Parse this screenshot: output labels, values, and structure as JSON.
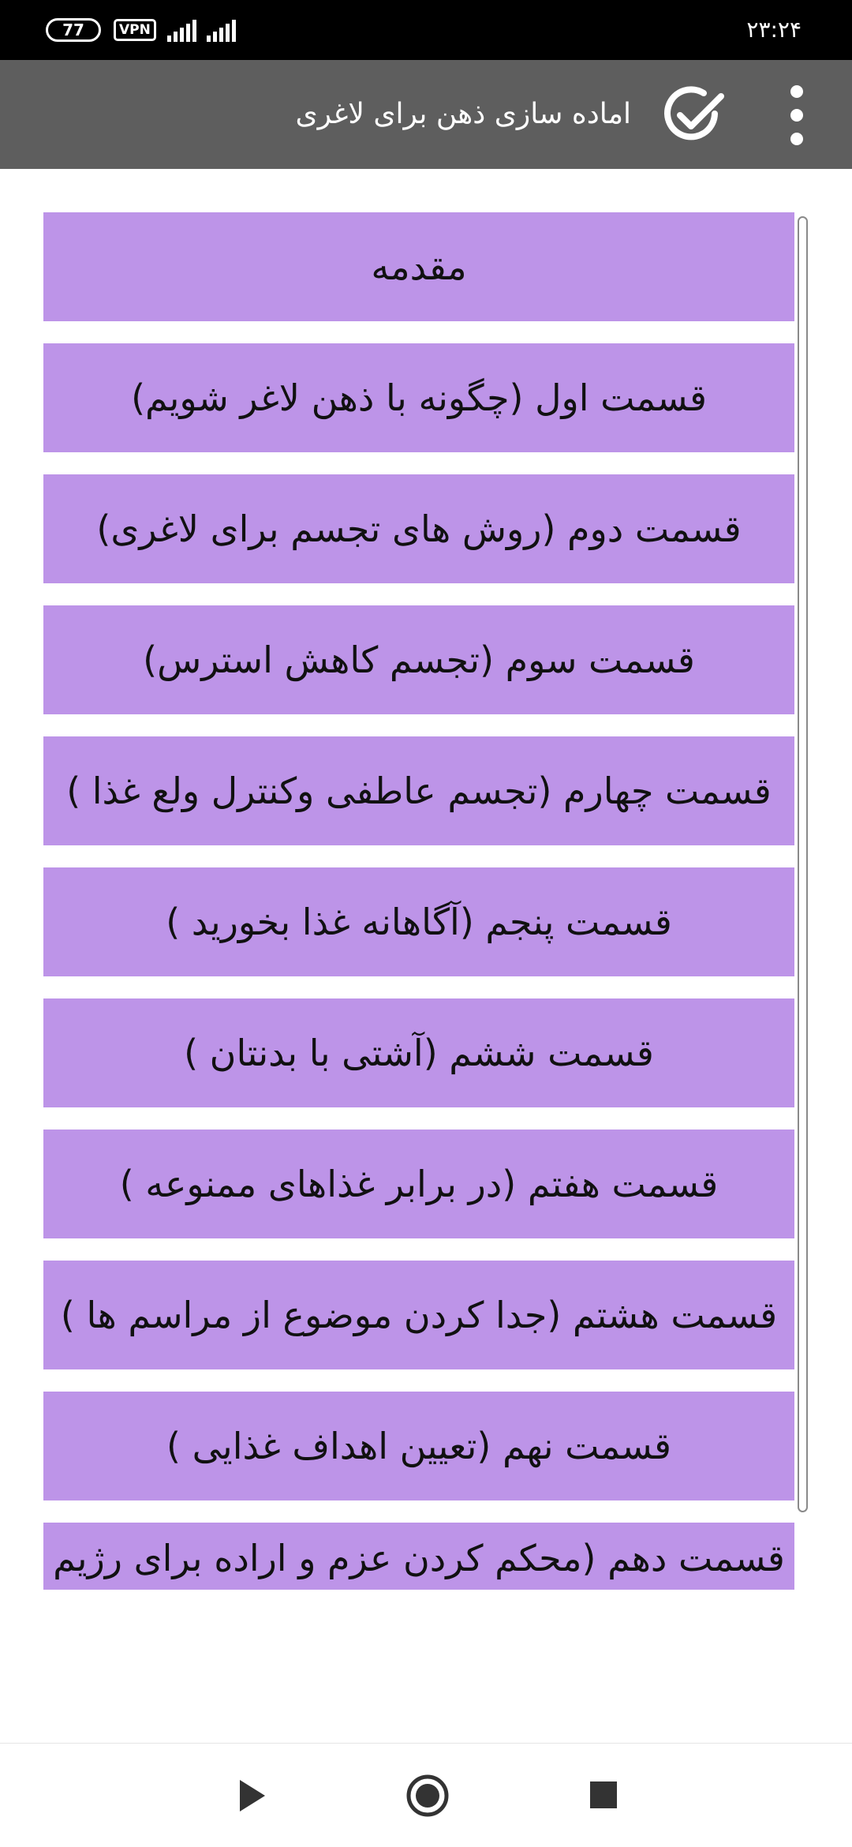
{
  "status_bar": {
    "battery": "77",
    "vpn": "VPN",
    "time": "۲۳:۲۴"
  },
  "app_bar": {
    "title": "اماده سازی ذهن برای لاغری",
    "check_icon": "check-circle-icon",
    "menu_icon": "more-vert-icon"
  },
  "list": {
    "items": [
      "مقدمه",
      "قسمت اول (چگونه با ذهن لاغر شویم)",
      "قسمت دوم (روش های تجسم برای لاغری)",
      "قسمت سوم (تجسم کاهش استرس)",
      "قسمت چهارم (تجسم عاطفی وکنترل ولع غذا )",
      "قسمت پنجم (آگاهانه غذا بخورید )",
      "قسمت ششم (آشتی با بدنتان )",
      "قسمت هفتم (در برابر غذاهای ممنوعه )",
      "قسمت هشتم (جدا کردن موضوع از مراسم ها )",
      "قسمت نهم (تعیین اهداف غذایی )",
      "قسمت دهم (محکم کردن عزم و اراده برای رژیم"
    ]
  },
  "nav_bar": {
    "back_icon": "back-triangle-icon",
    "home_icon": "home-circle-icon",
    "recents_icon": "recents-square-icon"
  },
  "colors": {
    "item_bg": "#bd94e8",
    "app_bar": "#5e5e5e",
    "status_bar": "#000000"
  }
}
